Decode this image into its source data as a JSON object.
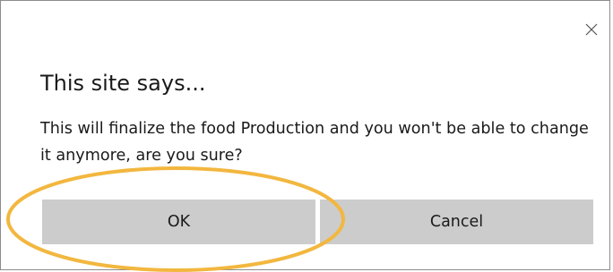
{
  "dialog": {
    "title": "This site says...",
    "message": "This will finalize the food Production and you won't be able to change it anymore, are you sure?",
    "ok_label": "OK",
    "cancel_label": "Cancel",
    "close_icon": "close-icon"
  },
  "annotation": {
    "type": "highlight-ellipse",
    "target": "ok-button",
    "color": "#F2B73F"
  },
  "colors": {
    "button_bg": "#CCCCCC",
    "border": "#8C8C8C",
    "text": "#1A1A1A"
  }
}
